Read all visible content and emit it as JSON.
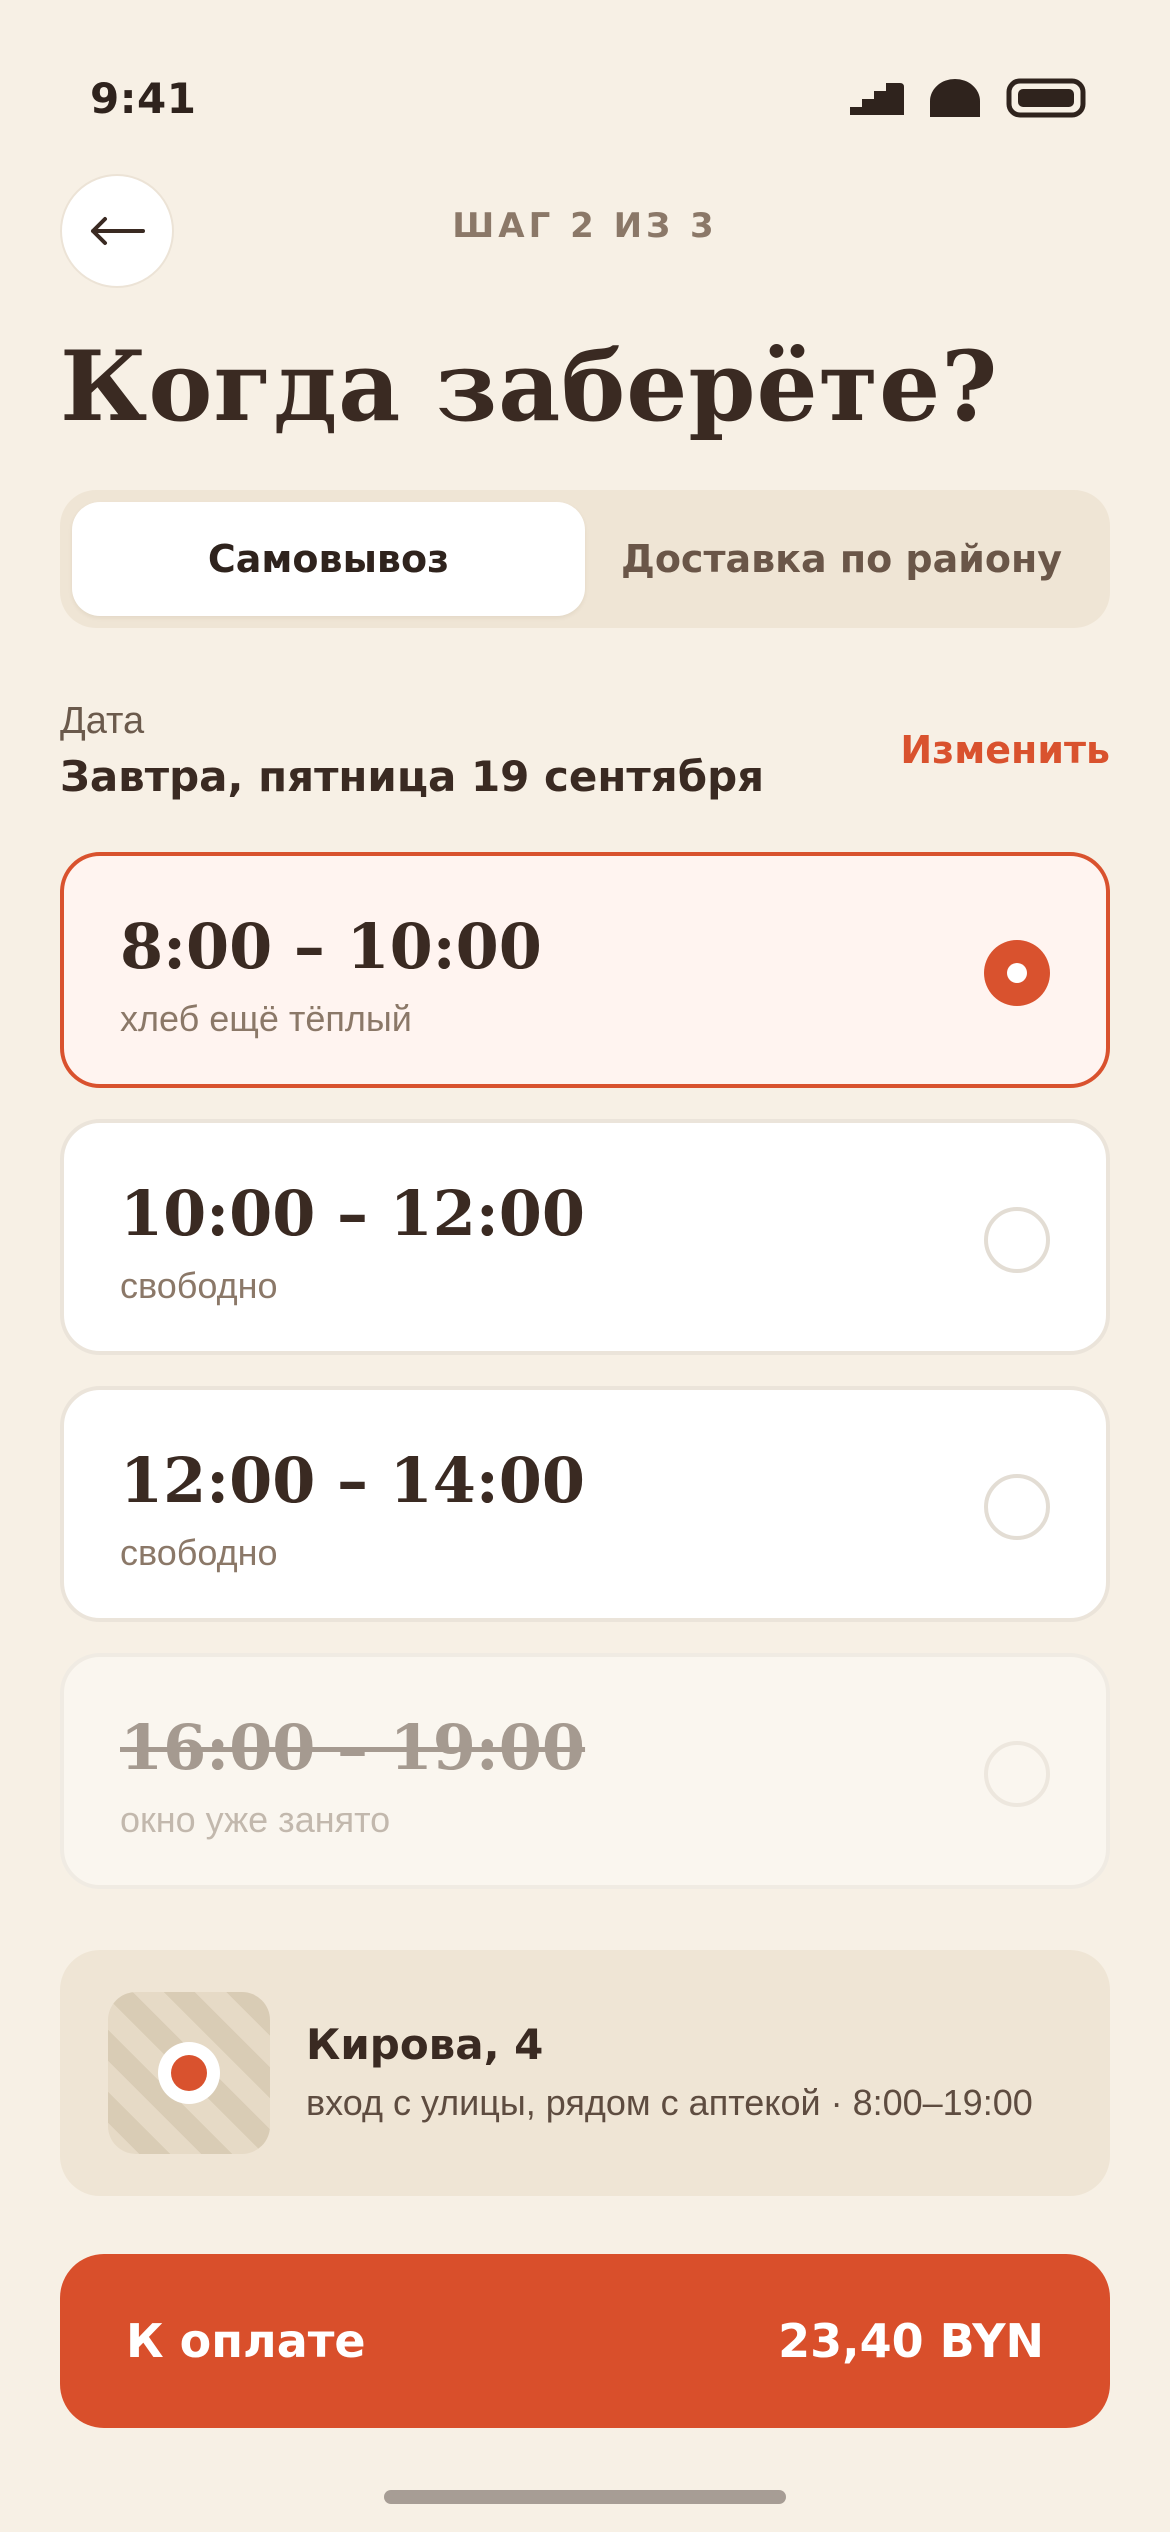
{
  "status_bar": {
    "time": "9:41"
  },
  "header": {
    "step": "ШАГ 2 ИЗ 3",
    "title": "Когда заберёте?"
  },
  "tabs": [
    {
      "label": "Самовывоз",
      "active": true
    },
    {
      "label": "Доставка по району",
      "active": false
    }
  ],
  "date": {
    "caption": "Дата",
    "value": "Завтра, пятница 19 сентября",
    "change_label": "Изменить"
  },
  "slots": [
    {
      "time": "8:00 – 10:00",
      "note": "хлеб ещё тёплый",
      "state": "selected"
    },
    {
      "time": "10:00 – 12:00",
      "note": "свободно",
      "state": "available"
    },
    {
      "time": "12:00 – 14:00",
      "note": "свободно",
      "state": "available"
    },
    {
      "time": "16:00 – 19:00",
      "note": "окно уже занято",
      "state": "unavailable"
    }
  ],
  "pickup": {
    "address": "Кирова, 4",
    "details": "вход с улицы, рядом с аптекой · 8:00–19:00"
  },
  "payment": {
    "label": "К оплате",
    "amount": "23,40 BYN"
  },
  "colors": {
    "background": "#f7f0e5",
    "accent": "#d9522e",
    "text": "#3a2a22",
    "muted": "#8b7868"
  }
}
